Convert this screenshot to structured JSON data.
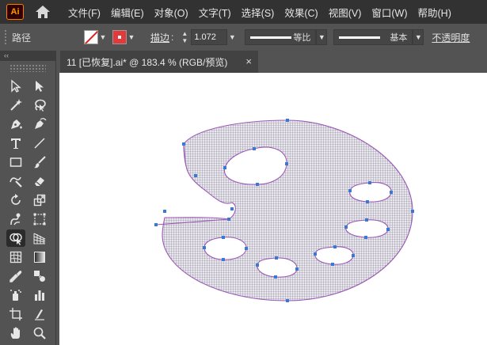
{
  "app": {
    "logo_text": "Ai",
    "accent_color": "#ff9a00"
  },
  "menu": {
    "items": [
      "文件(F)",
      "编辑(E)",
      "对象(O)",
      "文字(T)",
      "选择(S)",
      "效果(C)",
      "视图(V)",
      "窗口(W)",
      "帮助(H)"
    ]
  },
  "control": {
    "selection_label": "路径",
    "stroke_label": "描边",
    "stroke_colon": ":",
    "stroke_weight": "1.072",
    "variable_width_profile": "等比",
    "brush_definition": "基本",
    "opacity_label": "不透明度",
    "fill_color": "none",
    "stroke_color": "#e23a3a"
  },
  "tools": {
    "collapse_label": "‹‹"
  },
  "document": {
    "tab_title": "11 [已恢复].ai* @ 183.4 % (RGB/预览)",
    "close_symbol": "×"
  },
  "artwork": {
    "path_stroke_color": "#9b59b6",
    "anchor_color": "#3a78d6",
    "fill_pattern": "crosshatch-grid"
  }
}
